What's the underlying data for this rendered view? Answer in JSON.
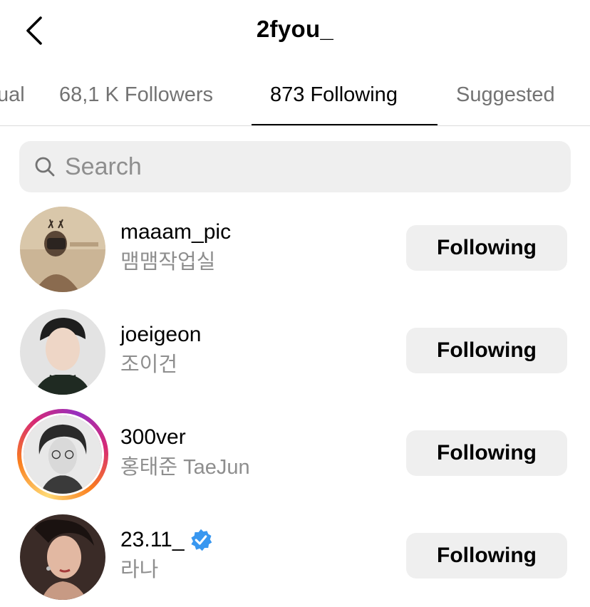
{
  "header": {
    "title": "2fyou_",
    "back_icon": "chevron-left-icon"
  },
  "tabs": [
    {
      "label": "ual",
      "active": false
    },
    {
      "label": "68,1 K Followers",
      "active": false
    },
    {
      "label": "873 Following",
      "active": true
    },
    {
      "label": "Suggested",
      "active": false
    }
  ],
  "search": {
    "placeholder": "Search",
    "value": "",
    "icon": "search-icon"
  },
  "accounts": [
    {
      "username": "maaam_pic",
      "full_name": "맴맴작업실",
      "button_label": "Following",
      "verified": false,
      "has_story": false
    },
    {
      "username": "joeigeon",
      "full_name": "조이건",
      "button_label": "Following",
      "verified": false,
      "has_story": false
    },
    {
      "username": "300ver",
      "full_name": "홍태준 TaeJun",
      "button_label": "Following",
      "verified": false,
      "has_story": true
    },
    {
      "username": "23.11_",
      "full_name": "라나",
      "button_label": "Following",
      "verified": true,
      "has_story": false
    }
  ],
  "colors": {
    "button_bg": "#efefef",
    "secondary_text": "#8e8e8e",
    "verified_blue": "#3897f0"
  }
}
